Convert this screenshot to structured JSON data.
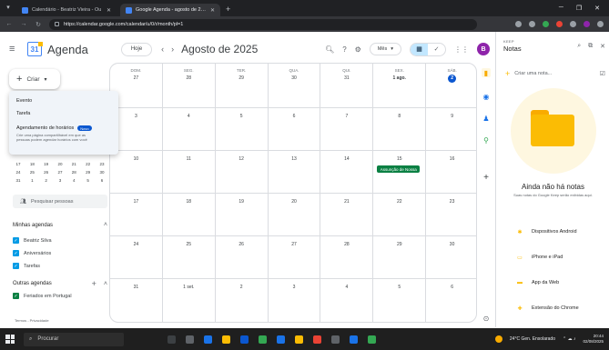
{
  "browser": {
    "tabs": [
      {
        "label": "Calendário - Beatriz Vieira - Ou",
        "active": false
      },
      {
        "label": "Google Agenda - agosto de 2025",
        "active": true
      }
    ],
    "url": "https://calendar.google.com/calendar/u/0/r/month/pl=1"
  },
  "header": {
    "app_title": "Agenda",
    "today_label": "Hoje",
    "month_title": "Agosto de 2025",
    "view_label": "Mês",
    "avatar_initial": "B"
  },
  "sidebar": {
    "create_label": "Criar",
    "create_menu": {
      "event": "Evento",
      "task": "Tarefa",
      "booking_title": "Agendamento de horários",
      "booking_badge": "Novo",
      "booking_desc": "Crie uma página compartilhável em que as pessoas podem agendar horários com você"
    },
    "mini_calendar_rows": [
      [
        "17",
        "18",
        "19",
        "20",
        "21",
        "22",
        "23"
      ],
      [
        "24",
        "25",
        "26",
        "27",
        "28",
        "29",
        "30"
      ],
      [
        "31",
        "1",
        "2",
        "3",
        "4",
        "5",
        "6"
      ]
    ],
    "search_people": "Pesquisar pessoas",
    "my_calendars_title": "Minhas agendas",
    "my_calendars": [
      {
        "label": "Beatriz Silva",
        "color": "#039be5"
      },
      {
        "label": "Aniversários",
        "color": "#039be5"
      },
      {
        "label": "Tarefas",
        "color": "#039be5"
      }
    ],
    "other_calendars_title": "Outras agendas",
    "other_calendars": [
      {
        "label": "Feriados em Portugal",
        "color": "#0b8043"
      }
    ],
    "footer": "Termos - Privacidade"
  },
  "grid": {
    "weeks": [
      {
        "days": [
          {
            "dow": "DOM.",
            "num": "27"
          },
          {
            "dow": "SEG.",
            "num": "28"
          },
          {
            "dow": "TER.",
            "num": "29"
          },
          {
            "dow": "QUA.",
            "num": "30"
          },
          {
            "dow": "QUI.",
            "num": "31"
          },
          {
            "dow": "SEX.",
            "num": "1 ago.",
            "first": true
          },
          {
            "dow": "SÁB.",
            "num": "2",
            "today": true
          }
        ]
      },
      {
        "days": [
          {
            "num": "3"
          },
          {
            "num": "4"
          },
          {
            "num": "5"
          },
          {
            "num": "6"
          },
          {
            "num": "7"
          },
          {
            "num": "8"
          },
          {
            "num": "9"
          }
        ]
      },
      {
        "days": [
          {
            "num": "10"
          },
          {
            "num": "11"
          },
          {
            "num": "12"
          },
          {
            "num": "13"
          },
          {
            "num": "14"
          },
          {
            "num": "15",
            "event": "Assunção de Nossa"
          },
          {
            "num": "16"
          }
        ]
      },
      {
        "days": [
          {
            "num": "17"
          },
          {
            "num": "18"
          },
          {
            "num": "19"
          },
          {
            "num": "20"
          },
          {
            "num": "21"
          },
          {
            "num": "22"
          },
          {
            "num": "23"
          }
        ]
      },
      {
        "days": [
          {
            "num": "24"
          },
          {
            "num": "25"
          },
          {
            "num": "26"
          },
          {
            "num": "27"
          },
          {
            "num": "28"
          },
          {
            "num": "29"
          },
          {
            "num": "30"
          }
        ]
      },
      {
        "days": [
          {
            "num": "31"
          },
          {
            "num": "1 set."
          },
          {
            "num": "2"
          },
          {
            "num": "3"
          },
          {
            "num": "4"
          },
          {
            "num": "5"
          },
          {
            "num": "6"
          }
        ]
      }
    ],
    "event_color": "#0b8043"
  },
  "keep": {
    "brand": "KEEP",
    "title": "Notas",
    "input_placeholder": "Criar uma nota...",
    "empty_title": "Ainda não há notas",
    "empty_sub": "Suas notas do Google Keep serão exibidas aqui.",
    "links": [
      {
        "label": "Dispositivos Android",
        "icon": "android-icon",
        "color": "#fbbc04"
      },
      {
        "label": "iPhone e iPad",
        "icon": "apple-icon",
        "color": "#fbbc04"
      },
      {
        "label": "App da Web",
        "icon": "web-icon",
        "color": "#fbbc04"
      },
      {
        "label": "Extensão do Chrome",
        "icon": "puzzle-icon",
        "color": "#fbbc04"
      }
    ]
  },
  "taskbar": {
    "search_placeholder": "Procurar",
    "weather": "24°C Gen. Ensolarado",
    "time": "20:44",
    "date": "02/08/2025"
  }
}
